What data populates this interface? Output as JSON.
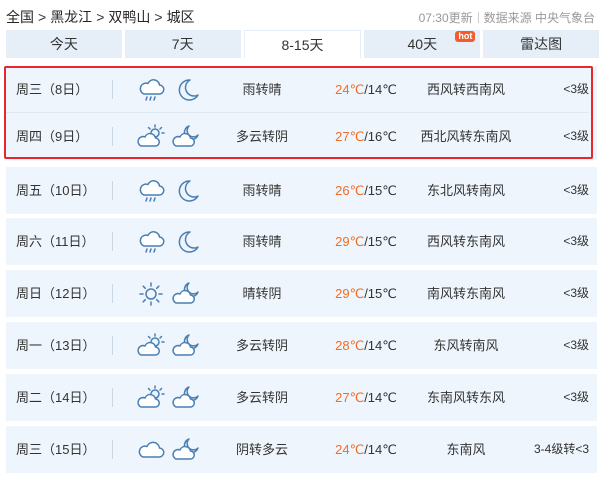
{
  "breadcrumb": {
    "items": [
      "全国",
      "黑龙江",
      "双鸭山",
      "城区"
    ],
    "separator": ">"
  },
  "meta": {
    "update_time": "07:30更新",
    "source": "数据来源 中央气象台"
  },
  "tabs": [
    {
      "label": "今天",
      "active": false
    },
    {
      "label": "7天",
      "active": false
    },
    {
      "label": "8-15天",
      "active": true
    },
    {
      "label": "40天",
      "active": false,
      "badge": "hot"
    },
    {
      "label": "雷达图",
      "active": false
    }
  ],
  "colors": {
    "row_bg": "#eef5fc",
    "tab_bg": "#e6eff8",
    "high_temp": "#f06d25",
    "highlight_border": "#e9262b",
    "hot_badge": "#f25c2f",
    "icon_stroke": "#4a7fb3"
  },
  "forecast": [
    {
      "date": "周三（8日）",
      "icon_day": "cloud-rain-icon",
      "icon_night": "moon-icon",
      "desc": "雨转晴",
      "high": "24℃",
      "low": "/14℃",
      "wind": "西风转西南风",
      "level": "<3级"
    },
    {
      "date": "周四（9日）",
      "icon_day": "partly-cloudy-day-icon",
      "icon_night": "partly-cloudy-night-icon",
      "desc": "多云转阴",
      "high": "27℃",
      "low": "/16℃",
      "wind": "西北风转东南风",
      "level": "<3级"
    },
    {
      "date": "周五（10日）",
      "icon_day": "cloud-rain-icon",
      "icon_night": "moon-icon",
      "desc": "雨转晴",
      "high": "26℃",
      "low": "/15℃",
      "wind": "东北风转南风",
      "level": "<3级"
    },
    {
      "date": "周六（11日）",
      "icon_day": "cloud-rain-icon",
      "icon_night": "moon-icon",
      "desc": "雨转晴",
      "high": "29℃",
      "low": "/15℃",
      "wind": "西风转东南风",
      "level": "<3级"
    },
    {
      "date": "周日（12日）",
      "icon_day": "sun-icon",
      "icon_night": "partly-cloudy-night-icon",
      "desc": "晴转阴",
      "high": "29℃",
      "low": "/15℃",
      "wind": "南风转东南风",
      "level": "<3级"
    },
    {
      "date": "周一（13日）",
      "icon_day": "partly-cloudy-day-icon",
      "icon_night": "partly-cloudy-night-icon",
      "desc": "多云转阴",
      "high": "28℃",
      "low": "/14℃",
      "wind": "东风转南风",
      "level": "<3级"
    },
    {
      "date": "周二（14日）",
      "icon_day": "partly-cloudy-day-icon",
      "icon_night": "partly-cloudy-night-icon",
      "desc": "多云转阴",
      "high": "27℃",
      "low": "/14℃",
      "wind": "东南风转东风",
      "level": "<3级"
    },
    {
      "date": "周三（15日）",
      "icon_day": "cloud-icon",
      "icon_night": "partly-cloudy-night-icon",
      "desc": "阴转多云",
      "high": "24℃",
      "low": "/14℃",
      "wind": "东南风",
      "level": "3-4级转<3"
    }
  ]
}
